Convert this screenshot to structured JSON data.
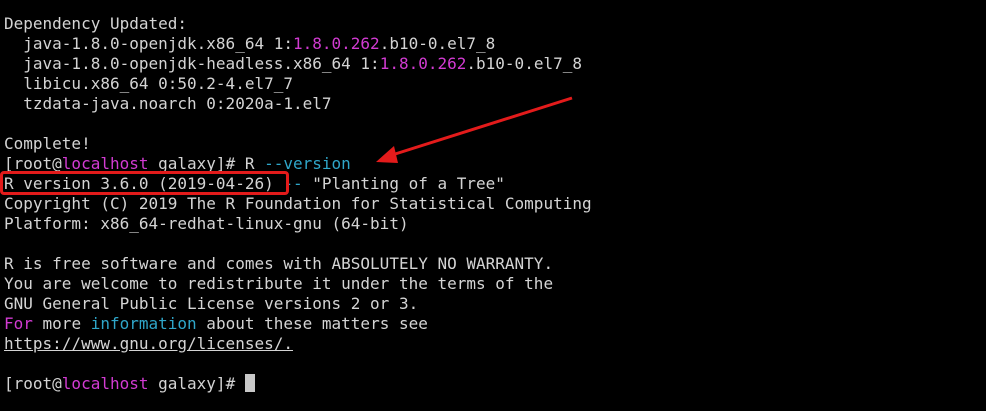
{
  "terminal": {
    "dep_header": "Dependency Updated:",
    "deps": [
      {
        "indent": "  ",
        "pre": "java-1.8.0-openjdk.x86_64 1:",
        "ver": "1.8.0.262",
        "post": ".b10-0.el7_8"
      },
      {
        "indent": "  ",
        "pre": "java-1.8.0-openjdk-headless.x86_64 1:",
        "ver": "1.8.0.262",
        "post": ".b10-0.el7_8"
      }
    ],
    "dep_plain": [
      "  libicu.x86_64 0:50.2-4.el7_7",
      "  tzdata-java.noarch 0:2020a-1.el7"
    ],
    "complete": "Complete!",
    "prompt1": {
      "pre": "[root@",
      "host": "localhost",
      "post": " galaxy]# ",
      "cmd": "R",
      "arg": " --version"
    },
    "version": {
      "highlighted": "R version 3.6.0 (2019-04-26)",
      "dash": " --",
      "nickname": " \"Planting of a Tree\""
    },
    "copyright": "Copyright (C) 2019 The R Foundation for Statistical Computing",
    "platform": "Platform: x86_64-redhat-linux-gnu (64-bit)",
    "license": [
      "R is free software and comes with ABSOLUTELY NO WARRANTY.",
      "You are welcome to redistribute it under the terms of the",
      "GNU General Public License versions 2 or 3."
    ],
    "info": {
      "for": "For",
      "more": " more ",
      "information": "information",
      "rest": " about these matters see"
    },
    "link": "https://www.gnu.org/licenses/.",
    "prompt2": {
      "pre": "[root@",
      "host": "localhost",
      "post": " galaxy]# "
    }
  },
  "annotation": {
    "box_color": "#e31b1b",
    "arrow_color": "#e31b1b"
  }
}
